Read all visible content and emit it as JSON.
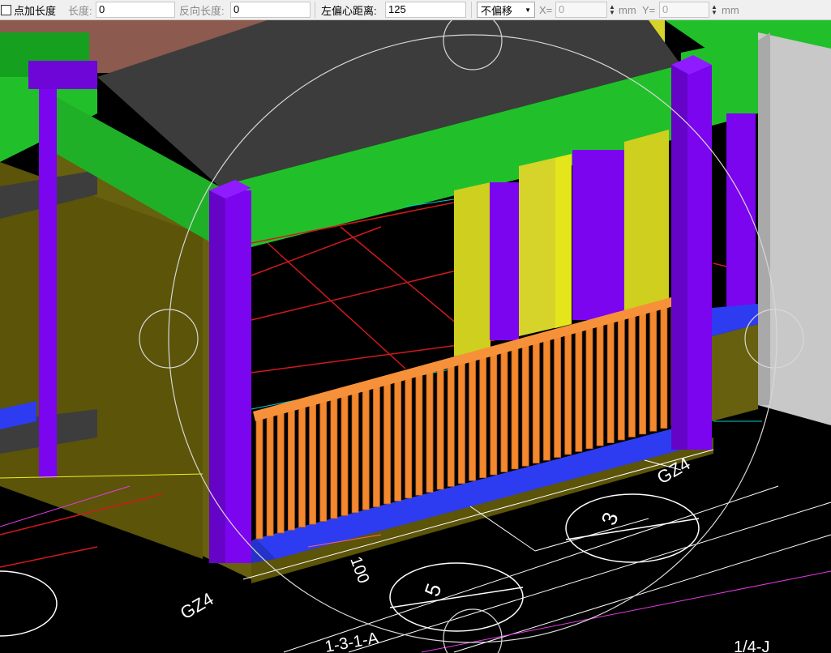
{
  "toolbar": {
    "add_length_label": "点加长度",
    "length_label": "长度:",
    "length_value": "0",
    "reverse_length_label": "反向长度:",
    "reverse_length_value": "0",
    "left_offset_label": "左偏心距离:",
    "left_offset_value": "125",
    "offset_mode": "不偏移",
    "x_label": "X=",
    "x_value": "0",
    "x_unit": "mm",
    "y_label": "Y=",
    "y_value": "0",
    "y_unit": "mm"
  },
  "viewport": {
    "labels": {
      "gz4_right": "GZ4",
      "gz4_left": "GZ4",
      "dim_100": "100",
      "axis_3": "3",
      "axis_5": "5",
      "axis_1_3_1_a": "1-3-1-A",
      "axis_1_4_j": "1/4-J"
    }
  },
  "colors": {
    "column": "#7b05ef",
    "beam": "#21c02a",
    "slab": "#3c3c3c",
    "wall": "#67600e",
    "railing": "#f3882e",
    "base_beam": "#2d3cf0",
    "yellow_wall": "#d6d42a",
    "red_grid": "#d11a1a"
  }
}
